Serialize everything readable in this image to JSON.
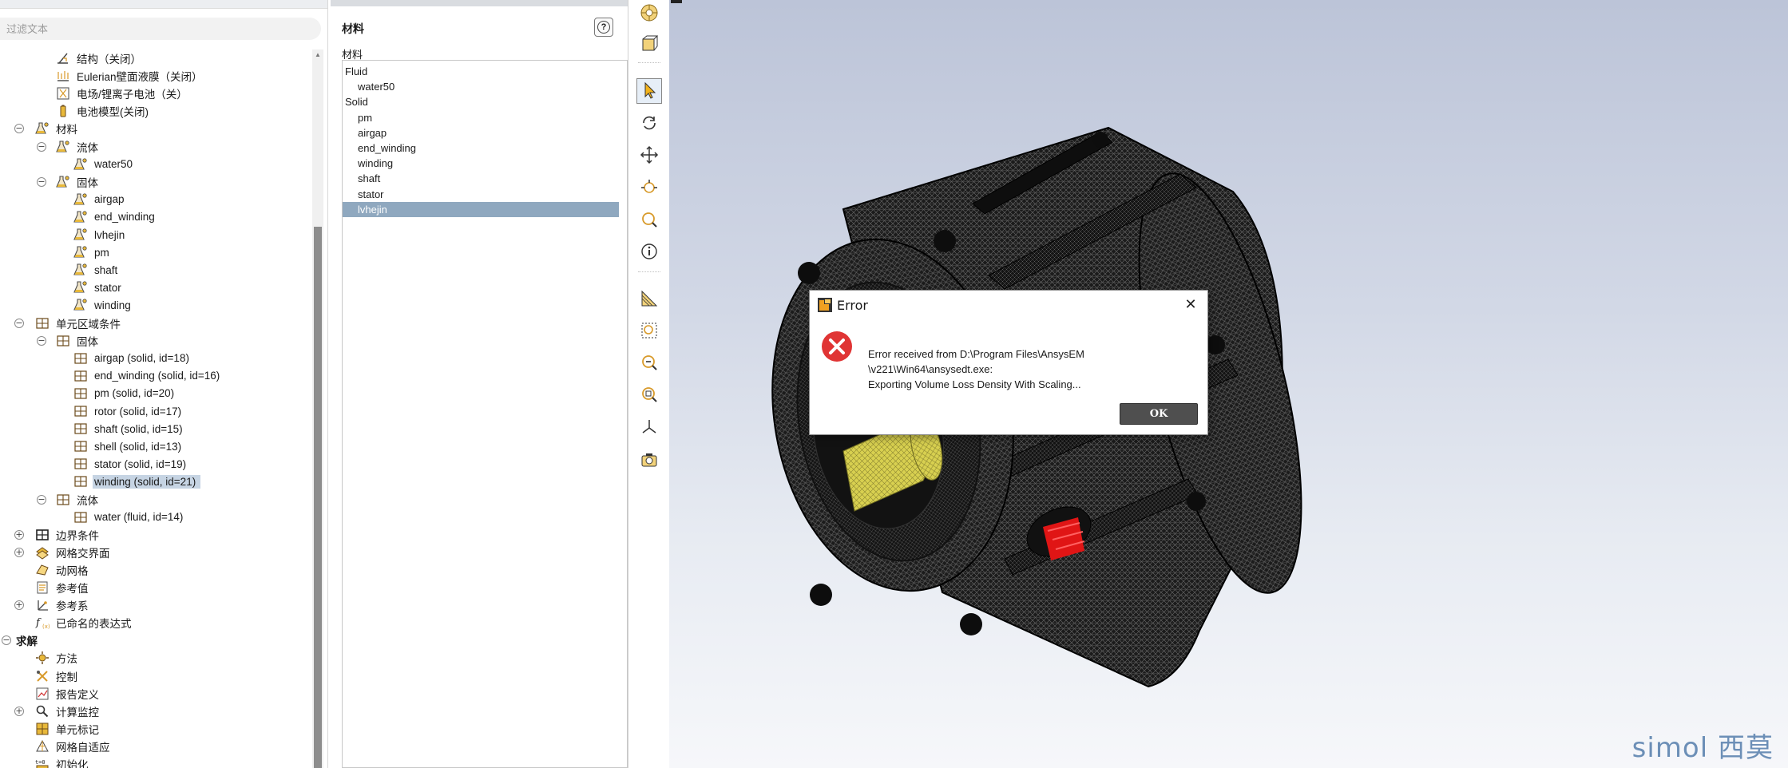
{
  "filter": {
    "placeholder": "过滤文本"
  },
  "tree": {
    "rows": [
      {
        "label": "结构（关闭）",
        "icon": "structure-icon",
        "indent": 2
      },
      {
        "label": "Eulerian壁面液膜（关闭）",
        "icon": "wall-film-icon",
        "indent": 2
      },
      {
        "label": "电场/锂离子电池（关）",
        "icon": "electric-field-icon",
        "indent": 2
      },
      {
        "label": "电池模型(关闭)",
        "icon": "battery-icon",
        "indent": 2
      },
      {
        "label": "材料",
        "icon": "material-icon",
        "indent": 1,
        "toggle": "−"
      },
      {
        "label": "流体",
        "icon": "material-icon",
        "indent": 2,
        "toggle": "−"
      },
      {
        "label": "water50",
        "icon": "material-icon",
        "indent": 3
      },
      {
        "label": "固体",
        "icon": "material-icon",
        "indent": 2,
        "toggle": "−"
      },
      {
        "label": "airgap",
        "icon": "material-icon",
        "indent": 3
      },
      {
        "label": "end_winding",
        "icon": "material-icon",
        "indent": 3
      },
      {
        "label": "lvhejin",
        "icon": "material-icon",
        "indent": 3
      },
      {
        "label": "pm",
        "icon": "material-icon",
        "indent": 3
      },
      {
        "label": "shaft",
        "icon": "material-icon",
        "indent": 3
      },
      {
        "label": "stator",
        "icon": "material-icon",
        "indent": 3
      },
      {
        "label": "winding",
        "icon": "material-icon",
        "indent": 3
      },
      {
        "label": "单元区域条件",
        "icon": "cell-zone-icon",
        "indent": 1,
        "toggle": "−"
      },
      {
        "label": "固体",
        "icon": "cell-zone-icon",
        "indent": 2,
        "toggle": "−"
      },
      {
        "label": "airgap (solid, id=18)",
        "icon": "cell-zone-icon",
        "indent": 3
      },
      {
        "label": "end_winding (solid, id=16)",
        "icon": "cell-zone-icon",
        "indent": 3
      },
      {
        "label": "pm (solid, id=20)",
        "icon": "cell-zone-icon",
        "indent": 3
      },
      {
        "label": "rotor (solid, id=17)",
        "icon": "cell-zone-icon",
        "indent": 3
      },
      {
        "label": "shaft (solid, id=15)",
        "icon": "cell-zone-icon",
        "indent": 3
      },
      {
        "label": "shell (solid, id=13)",
        "icon": "cell-zone-icon",
        "indent": 3
      },
      {
        "label": "stator (solid, id=19)",
        "icon": "cell-zone-icon",
        "indent": 3
      },
      {
        "label": "winding (solid, id=21)",
        "icon": "cell-zone-icon",
        "indent": 3,
        "selected": true
      },
      {
        "label": "流体",
        "icon": "cell-zone-icon",
        "indent": 2,
        "toggle": "−"
      },
      {
        "label": "water (fluid, id=14)",
        "icon": "cell-zone-icon",
        "indent": 3
      },
      {
        "label": "边界条件",
        "icon": "boundary-icon",
        "indent": 1,
        "toggle": "+"
      },
      {
        "label": "网格交界面",
        "icon": "mesh-interface-icon",
        "indent": 1,
        "toggle": "+"
      },
      {
        "label": "动网格",
        "icon": "dynamic-mesh-icon",
        "indent": 1
      },
      {
        "label": "参考值",
        "icon": "reference-values-icon",
        "indent": 1
      },
      {
        "label": "参考系",
        "icon": "reference-frame-icon",
        "indent": 1,
        "toggle": "+"
      },
      {
        "label": "已命名的表达式",
        "icon": "expression-icon",
        "indent": 1
      },
      {
        "label": "求解",
        "icon": "",
        "indent": 0,
        "toggle": "−",
        "bold": true
      },
      {
        "label": "方法",
        "icon": "methods-icon",
        "indent": 1
      },
      {
        "label": "控制",
        "icon": "controls-icon",
        "indent": 1
      },
      {
        "label": "报告定义",
        "icon": "report-icon",
        "indent": 1
      },
      {
        "label": "计算监控",
        "icon": "monitor-icon",
        "indent": 1,
        "toggle": "+"
      },
      {
        "label": "单元标记",
        "icon": "cell-register-icon",
        "indent": 1
      },
      {
        "label": "网格自适应",
        "icon": "mesh-adapt-icon",
        "indent": 1
      },
      {
        "label": "初始化",
        "icon": "initialize-icon",
        "indent": 1
      }
    ]
  },
  "materials_panel": {
    "title": "材料",
    "subtitle": "材料",
    "items": [
      {
        "label": "Fluid",
        "child": false
      },
      {
        "label": "water50",
        "child": true
      },
      {
        "label": "Solid",
        "child": false
      },
      {
        "label": "pm",
        "child": true
      },
      {
        "label": "airgap",
        "child": true
      },
      {
        "label": "end_winding",
        "child": true
      },
      {
        "label": "winding",
        "child": true
      },
      {
        "label": "shaft",
        "child": true
      },
      {
        "label": "stator",
        "child": true
      },
      {
        "label": "lvhejin",
        "child": true,
        "selected": true
      }
    ]
  },
  "toolbar": {
    "buttons": [
      {
        "name": "display-options-icon"
      },
      {
        "name": "view-box-icon"
      },
      {
        "name": "select-pointer-icon",
        "active": true
      },
      {
        "name": "rotate-icon"
      },
      {
        "name": "pan-icon"
      },
      {
        "name": "zoom-in-out-icon"
      },
      {
        "name": "zoom-icon"
      },
      {
        "name": "probe-info-icon"
      },
      {
        "name": "mesh-display-icon"
      },
      {
        "name": "fit-window-icon"
      },
      {
        "name": "zoom-out-icon"
      },
      {
        "name": "zoom-to-area-icon"
      },
      {
        "name": "axes-icon"
      },
      {
        "name": "snapshot-icon"
      }
    ]
  },
  "dialog": {
    "title": "Error",
    "message_lines": [
      "Error received from D:\\Program Files\\AnsysEM",
      "\\v221\\Win64\\ansysedt.exe:",
      "Exporting Volume Loss Density With Scaling..."
    ],
    "ok_label": "OK",
    "close_glyph": "✕"
  },
  "watermark": "simol 西莫",
  "colors": {
    "selection": "#c6d4e3",
    "list_selection": "#8fa8bf",
    "inlet": "#2233dd",
    "outlet": "#e01515",
    "shaft": "#d8d050",
    "error": "#e03434"
  }
}
